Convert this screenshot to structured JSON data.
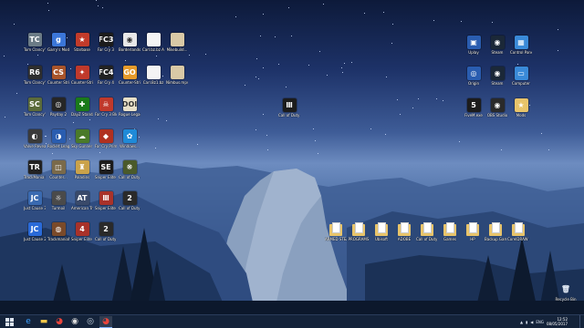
{
  "desktop": {
    "icons": [
      {
        "label": "Tom Clancy's Splinter Cell...",
        "bg": "#6b7b86",
        "glyph": "TC"
      },
      {
        "label": "Garry's Mod",
        "bg": "#3b76d8",
        "glyph": "g"
      },
      {
        "label": "Starbase",
        "bg": "#c23b2a",
        "glyph": "★"
      },
      {
        "label": "Far Cry 3",
        "bg": "#1c1c1c",
        "glyph": "FC3"
      },
      {
        "label": "Borderlands",
        "bg": "#e8e8e8",
        "glyph": "◉"
      },
      {
        "label": "Carl.bz.bz ARK",
        "bg": "#f4f4f4",
        "glyph": ""
      },
      {
        "label": "Mikebuild...",
        "bg": "#d9c9a6",
        "glyph": ""
      },
      {
        "label": "Tom Clancy's Rainbow Six",
        "bg": "#2e2e2e",
        "glyph": "R6"
      },
      {
        "label": "Counter Strike...",
        "bg": "#a8542a",
        "glyph": "CS"
      },
      {
        "label": "Counter-Strike Global...",
        "bg": "#c0392b",
        "glyph": "✦"
      },
      {
        "label": "Far Cry 4",
        "bg": "#222",
        "glyph": "FC4"
      },
      {
        "label": "Counter-Strike: Global Off...",
        "bg": "#e59a2a",
        "glyph": "GO"
      },
      {
        "label": "Carl.Bz1.bz",
        "bg": "#f4f4f4",
        "glyph": ""
      },
      {
        "label": "Nimbus.mp4...",
        "bg": "#d9c9a6",
        "glyph": ""
      },
      {
        "label": "Tom Clancy's Splinter Cell...",
        "bg": "#5b6b3a",
        "glyph": "SC"
      },
      {
        "label": "Payday 2",
        "bg": "#262626",
        "glyph": "◎"
      },
      {
        "label": "DayZ Standalone",
        "bg": "#1a7a1a",
        "glyph": "✚"
      },
      {
        "label": "Far Cry 3 Blood Dragon",
        "bg": "#c0392b",
        "glyph": "☠"
      },
      {
        "label": "Rogue Legacy",
        "bg": "#e8e0c8",
        "glyph": "DOI"
      },
      {
        "label": "Valve Reveal the Great...",
        "bg": "#3a3a3a",
        "glyph": "◐"
      },
      {
        "label": "Rocket League",
        "bg": "#2a5db0",
        "glyph": "◑"
      },
      {
        "label": "Sky Gunner Ace",
        "bg": "#4a7a2a",
        "glyph": "☁"
      },
      {
        "label": "Far Cry Primal",
        "bg": "#b03020",
        "glyph": "◆"
      },
      {
        "label": "Windows...",
        "bg": "#1f8ad8",
        "glyph": "✿"
      },
      {
        "label": "TrackMania Nations",
        "bg": "#222",
        "glyph": "TR"
      },
      {
        "label": "Counter...",
        "bg": "#7a6a4a",
        "glyph": "◫"
      },
      {
        "label": "Paladins",
        "bg": "#caa24a",
        "glyph": "♜"
      },
      {
        "label": "Sniper Elite 3",
        "bg": "#1c1c1c",
        "glyph": "SE"
      },
      {
        "label": "Call of Duty WWII",
        "bg": "#4a5a2a",
        "glyph": "❋"
      },
      {
        "label": "Just Cause 3 Multiplayer",
        "bg": "#3a6ab0",
        "glyph": "JC"
      },
      {
        "label": "Turmoil",
        "bg": "#4a4a4a",
        "glyph": "☼"
      },
      {
        "label": "American Truck Sim...",
        "bg": "#3a4a6a",
        "glyph": "AT"
      },
      {
        "label": "Sniper Elite 4",
        "bg": "#a8322a",
        "glyph": "Ⅲ"
      },
      {
        "label": "Call of Duty Modern...",
        "bg": "#2a2a2a",
        "glyph": "2"
      },
      {
        "label": "Just Cause 2",
        "bg": "#2a6ad8",
        "glyph": "JC"
      },
      {
        "label": "TrackmaniaNF",
        "bg": "#7a4a2a",
        "glyph": "◍"
      },
      {
        "label": "Sniper Elite 4",
        "bg": "#a8322a",
        "glyph": "4"
      },
      {
        "label": "Call of Duty Modern...",
        "bg": "#2a2a2a",
        "glyph": "2"
      },
      {
        "label": "Call of Duty Black Ops III",
        "bg": "#1c1c1c",
        "glyph": "Ⅲ"
      },
      {
        "label": "Uplay",
        "bg": "#2a5db0",
        "glyph": "▣"
      },
      {
        "label": "Steam",
        "bg": "#1b2838",
        "glyph": "◉"
      },
      {
        "label": "Control Panel",
        "bg": "#3a8ad8",
        "glyph": "▦"
      },
      {
        "label": "Origin",
        "bg": "#2a5db0",
        "glyph": "◎"
      },
      {
        "label": "Steam",
        "bg": "#1b2838",
        "glyph": "◉"
      },
      {
        "label": "Computer",
        "bg": "#3a8ad8",
        "glyph": "▭"
      },
      {
        "label": "FiveM.exe",
        "bg": "#1c1c1c",
        "glyph": "5"
      },
      {
        "label": "OBS Studio",
        "bg": "#2a2a2a",
        "glyph": "◉"
      },
      {
        "label": "Mods",
        "bg": "#e8c46a",
        "glyph": "★"
      }
    ],
    "folders": [
      {
        "label": "ARMED STEAM"
      },
      {
        "label": "PROGRAMS"
      },
      {
        "label": "Ubisoft"
      },
      {
        "label": "ADOBE"
      },
      {
        "label": "Call of Duty Black Ops..."
      },
      {
        "label": "Games"
      },
      {
        "label": "HP"
      },
      {
        "label": "Backup Games..."
      },
      {
        "label": "CorelDRAW Graphics Su..."
      }
    ],
    "recycle_bin": {
      "label": "Recycle Bin"
    }
  },
  "taskbar": {
    "start_icon": "start-icon",
    "pinned": [
      {
        "name": "internet-explorer",
        "glyph": "e",
        "color": "#3aa0ff"
      },
      {
        "name": "file-explorer",
        "glyph": "▬",
        "color": "#f0c64a"
      },
      {
        "name": "chrome",
        "glyph": "◕",
        "color": "#e8453c"
      },
      {
        "name": "obs",
        "glyph": "◉",
        "color": "#dddddd"
      },
      {
        "name": "steam",
        "glyph": "◎",
        "color": "#c7d5e0"
      },
      {
        "name": "chrome",
        "glyph": "◕",
        "color": "#e8453c"
      }
    ],
    "tray": {
      "language": "ENG",
      "time": "12:52",
      "date": "08/05/2017"
    }
  },
  "colors": {
    "taskbar": "#14233a",
    "accent": "#7fb3ff"
  }
}
